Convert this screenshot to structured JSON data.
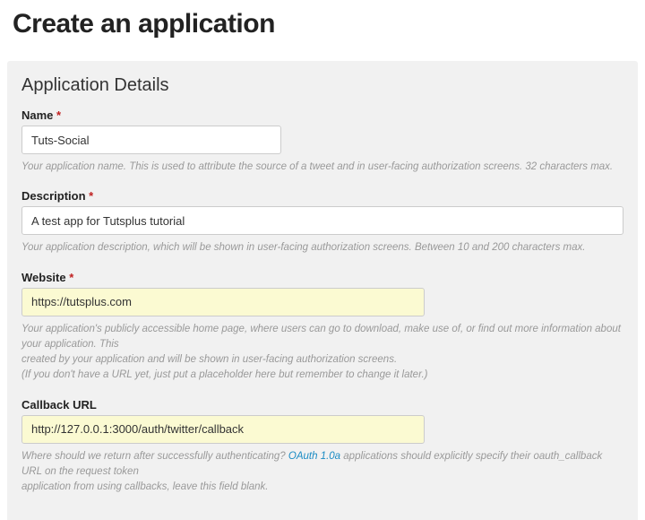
{
  "page_title": "Create an application",
  "panel_title": "Application Details",
  "fields": {
    "name": {
      "label": "Name",
      "required_marker": "*",
      "value": "Tuts-Social",
      "help": "Your application name. This is used to attribute the source of a tweet and in user-facing authorization screens. 32 characters max."
    },
    "description": {
      "label": "Description",
      "required_marker": "*",
      "value": "A test app for Tutsplus tutorial",
      "help": "Your application description, which will be shown in user-facing authorization screens. Between 10 and 200 characters max."
    },
    "website": {
      "label": "Website",
      "required_marker": "*",
      "value": "https://tutsplus.com",
      "help1": "Your application's publicly accessible home page, where users can go to download, make use of, or find out more information about your application. This",
      "help2": "created by your application and will be shown in user-facing authorization screens.",
      "help3": "(If you don't have a URL yet, just put a placeholder here but remember to change it later.)"
    },
    "callback": {
      "label": "Callback URL",
      "value": "http://127.0.0.1:3000/auth/twitter/callback",
      "help_pre": "Where should we return after successfully authenticating? ",
      "help_link": "OAuth 1.0a",
      "help_post": " applications should explicitly specify their oauth_callback URL on the request token",
      "help_line2": "application from using callbacks, leave this field blank."
    }
  }
}
